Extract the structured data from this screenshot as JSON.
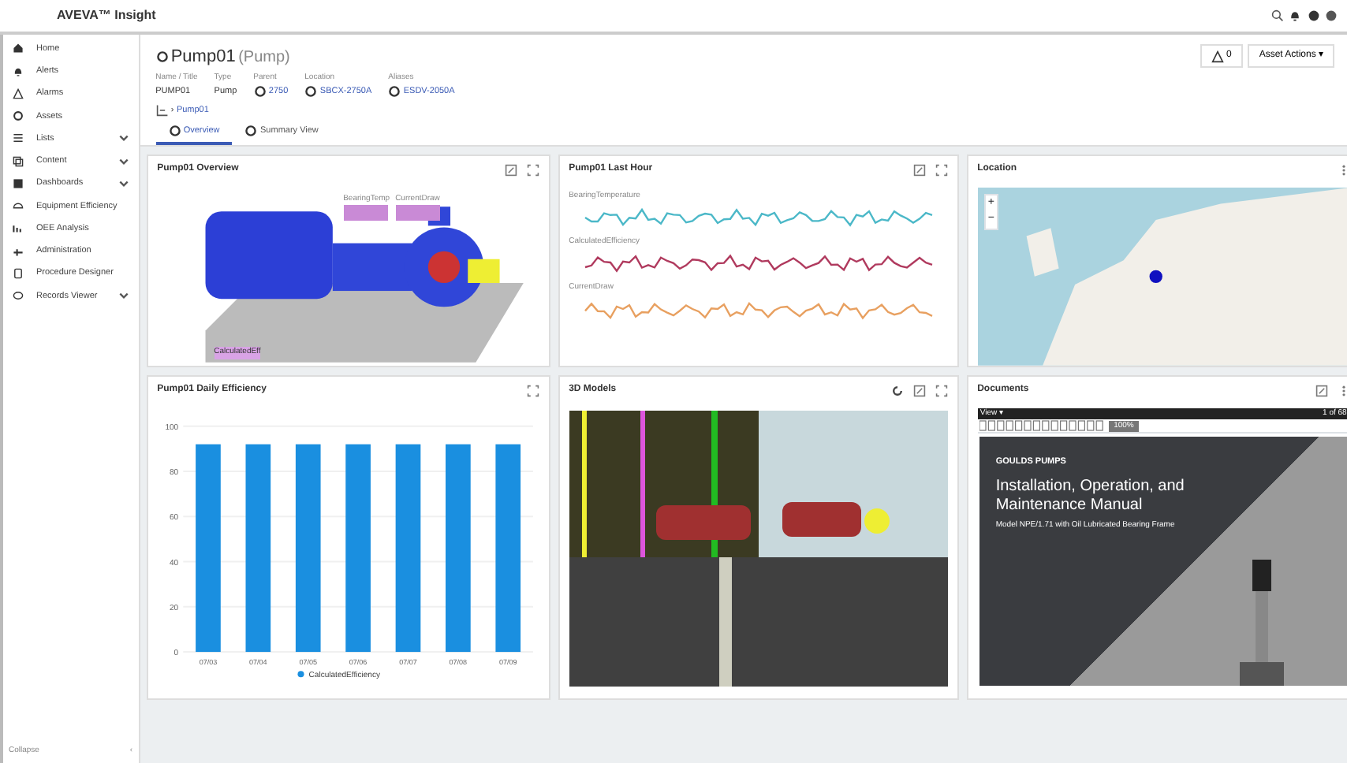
{
  "app": {
    "logo": "AVEVA™ Insight"
  },
  "sidebar": {
    "items": [
      {
        "label": "Home",
        "expandable": false
      },
      {
        "label": "Alerts",
        "expandable": false
      },
      {
        "label": "Alarms",
        "expandable": false
      },
      {
        "label": "Assets",
        "expandable": false
      },
      {
        "label": "Lists",
        "expandable": true
      },
      {
        "label": "Content",
        "expandable": true
      },
      {
        "label": "Dashboards",
        "expandable": true
      },
      {
        "label": "Equipment Efficiency",
        "expandable": false
      },
      {
        "label": "OEE Analysis",
        "expandable": false
      },
      {
        "label": "Administration",
        "expandable": false
      },
      {
        "label": "Procedure Designer",
        "expandable": false
      },
      {
        "label": "Records Viewer",
        "expandable": true
      }
    ],
    "collapse": {
      "label": "Collapse",
      "arrow": "‹"
    }
  },
  "asset": {
    "name": "Pump01",
    "type_label": "(Pump)",
    "fields": [
      {
        "label": "Name / Title",
        "value": "PUMP01",
        "link": false
      },
      {
        "label": "Type",
        "value": "Pump",
        "link": false
      },
      {
        "label": "Parent",
        "value": "2750",
        "link": true
      },
      {
        "label": "Location",
        "value": "SBCX-2750A",
        "link": true
      },
      {
        "label": "Aliases",
        "value": "ESDV-2050A",
        "link": true
      }
    ],
    "breadcrumb": [
      "›",
      "Pump01"
    ],
    "alert_count": "0",
    "actions_button": "Asset Actions ▾"
  },
  "tabs": [
    {
      "label": "Overview",
      "selected": true
    },
    {
      "label": "Summary View",
      "selected": false
    }
  ],
  "widgets": [
    {
      "kind": "pump",
      "title": "Pump01 Overview",
      "tags": [
        "BearingTemp",
        "CurrentDraw"
      ],
      "caption": "CalculatedEff"
    },
    {
      "kind": "trends",
      "title": "Pump01 Last Hour",
      "series": [
        {
          "name": "BearingTemperature",
          "color": "#4bb8c8"
        },
        {
          "name": "CalculatedEfficiency",
          "color": "#b03a5e"
        },
        {
          "name": "CurrentDraw",
          "color": "#e8a060"
        }
      ]
    },
    {
      "kind": "map",
      "title": "Location",
      "zoom_in": "+",
      "zoom_out": "−"
    },
    {
      "kind": "bars",
      "title": "Pump01 Daily Efficiency",
      "chart_data": {
        "type": "bar",
        "categories": [
          "07/03",
          "07/04",
          "07/05",
          "07/06",
          "07/07",
          "07/08",
          "07/09"
        ],
        "series": [
          {
            "name": "CalculatedEfficiency",
            "color": "#1a8fe0",
            "values": [
              92,
              92,
              92,
              92,
              92,
              92,
              92
            ]
          }
        ],
        "ylim": [
          0,
          100
        ],
        "yticks": [
          0,
          20,
          40,
          60,
          80,
          100
        ],
        "grid": true
      }
    },
    {
      "kind": "model",
      "title": "3D Models"
    },
    {
      "kind": "document",
      "title": "Documents",
      "viewer_menu": "View ▾",
      "page_info": "1 of 68",
      "zoom": "100%",
      "brand": "GOULDS PUMPS",
      "doc_title": "Installation, Operation, and Maintenance Manual",
      "doc_subtitle": "Model NPE/1.71 with Oil Lubricated Bearing Frame"
    }
  ]
}
